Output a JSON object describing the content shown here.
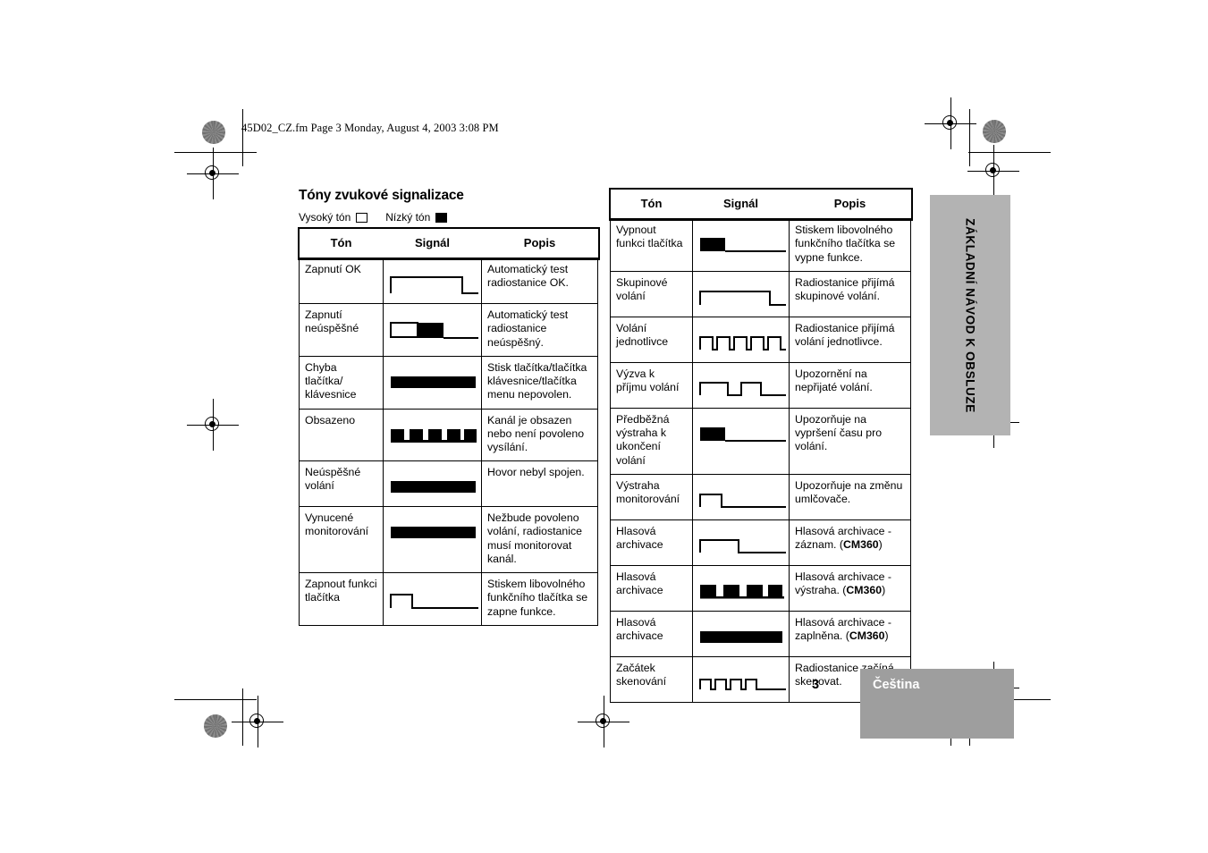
{
  "print_header": {
    "file_info": "45D02_CZ.fm  Page 3  Monday, August 4, 2003  3:08 PM"
  },
  "content": {
    "title": "Tóny zvukové signalizace",
    "legend": {
      "high_tone_label": "Vysoký tón",
      "low_tone_label": "Nízký tón"
    }
  },
  "tables": {
    "headers": {
      "tone": "Tón",
      "signal": "Signál",
      "description": "Popis"
    },
    "left_rows": [
      {
        "tone": "Zapnutí OK",
        "description": "Automatický test radiostanice OK.",
        "signal": "high-long-pulse"
      },
      {
        "tone": "Zapnutí neúspěšné",
        "description": "Automatický test radiostanice neúspěšný.",
        "signal": "high-then-low"
      },
      {
        "tone": "Chyba tlačítka/ klávesnice",
        "description": "Stisk tlačítka/tlačítka klávesnice/tlačítka menu nepovolen.",
        "signal": "low-solid-bar"
      },
      {
        "tone": "Obsazeno",
        "description": "Kanál je obsazen nebo není povoleno vysílání.",
        "signal": "low-five-pulses"
      },
      {
        "tone": "Neúspěšné volání",
        "description": "Hovor nebyl spojen.",
        "signal": "low-solid-bar"
      },
      {
        "tone": "Vynucené monitorování",
        "description": "Nežbude povoleno volání, radiostanice musí monitorovat kanál.",
        "signal": "low-solid-bar"
      },
      {
        "tone": "Zapnout funkci tlačítka",
        "description": "Stiskem libovolného funkčního tlačítka se zapne funkce.",
        "signal": "high-short-pulse"
      }
    ],
    "right_rows": [
      {
        "tone": "Vypnout funkci tlačítka",
        "description": "Stiskem libovolného funkčního tlačítka se vypne funkce.",
        "signal": "low-short-bar"
      },
      {
        "tone": "Skupinové volání",
        "description": "Radiostanice přijímá skupinové volání.",
        "signal": "high-long-pulse"
      },
      {
        "tone": "Volání jednotlivce",
        "description": "Radiostanice přijímá volání jednotlivce.",
        "signal": "high-five-pulses"
      },
      {
        "tone": "Výzva k příjmu volání",
        "description": "Upozornění na nepřijaté volání.",
        "signal": "high-two-pulses"
      },
      {
        "tone": "Předběžná výstraha k ukončení volání",
        "description": "Upozorňuje na vypršení času pro volání.",
        "signal": "low-short-bar"
      },
      {
        "tone": "Výstraha monitorování",
        "description": "Upozorňuje na změnu umlčovače.",
        "signal": "high-short-pulse"
      },
      {
        "tone": "Hlasová archivace",
        "description": "Hlasová archivace - záznam. (CM360)",
        "description_plain": "Hlasová archivace - záznam. (",
        "description_bold": "CM360",
        "description_tail": ")",
        "signal": "high-medium-pulse"
      },
      {
        "tone": "Hlasová archivace",
        "description": "Hlasová archivace - výstraha. (CM360)",
        "description_plain": "Hlasová archivace - výstraha. (",
        "description_bold": "CM360",
        "description_tail": ")",
        "signal": "low-four-pulses"
      },
      {
        "tone": "Hlasová archivace",
        "description": "Hlasová archivace - zaplněna. (CM360)",
        "description_plain": "Hlasová archivace - zaplněna. (",
        "description_bold": "CM360",
        "description_tail": ")",
        "signal": "low-solid-bar"
      },
      {
        "tone": "Začátek skenování",
        "description": "Radiostanice začíná skenovat.",
        "signal": "high-four-small-pulses"
      }
    ]
  },
  "side_tab": {
    "label": "ZÁKLADNÍ NÁVOD K OBSLUZE",
    "background_color": "#b3b3b3"
  },
  "footer": {
    "page_number": "3",
    "language": "Čeština",
    "bar_color": "#9e9e9e"
  }
}
